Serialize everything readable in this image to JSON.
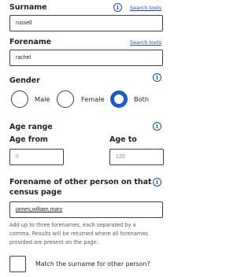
{
  "surname": {
    "label": "Surname",
    "search_tools": "Search tools",
    "value": "russell"
  },
  "forename": {
    "label": "Forename",
    "search_tools": "Search tools",
    "value": "rachel"
  },
  "gender": {
    "label": "Gender",
    "options": [
      "Male",
      "Female",
      "Both"
    ],
    "selected": "Both"
  },
  "age_range": {
    "label": "Age range",
    "from_label": "Age from",
    "to_label": "Age to",
    "from_value": "0",
    "to_value": "120"
  },
  "other_person": {
    "label_line1": "Forename of other person on that",
    "label_line2": "census page",
    "value": "james,william,mary",
    "help_line1": "Add up to three forenames, each separated by a",
    "help_line2": "comma. Results will be returned where all forenames",
    "help_line3": "provided are present on the page."
  },
  "match_surname": {
    "label": "Match the surname for other person?",
    "checked": false
  },
  "icons": {
    "info": "info-icon"
  },
  "colors": {
    "accent": "#1a5bc4",
    "link": "#1f4ea3",
    "text": "#1f2429"
  }
}
